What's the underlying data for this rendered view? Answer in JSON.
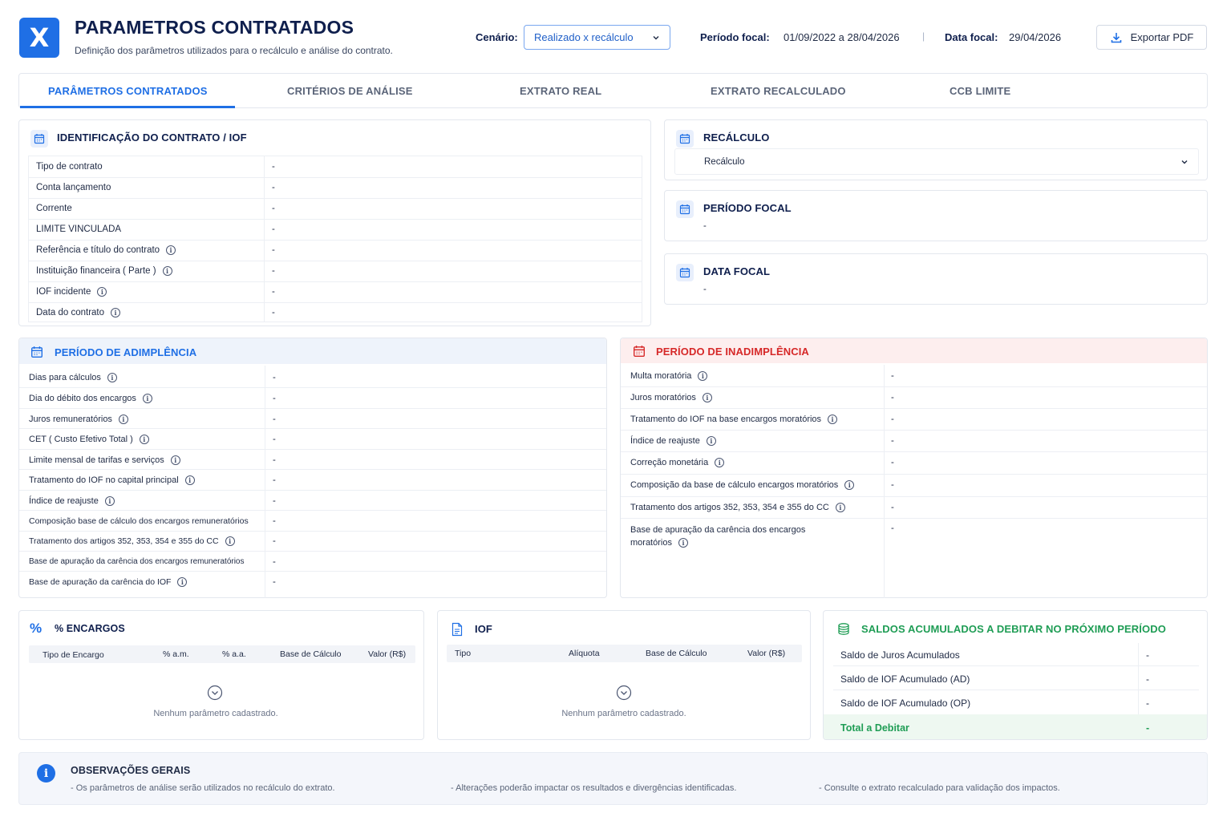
{
  "header": {
    "logo_letter": "X",
    "title": "PARAMETROS CONTRATADOS",
    "subtitle": "Definição dos parâmetros utilizados para o recálculo e análise do contrato.",
    "cenario_label": "Cenário:",
    "cenario_value": "Realizado x recálculo",
    "periodo_label": "Período focal:",
    "periodo_value": "01/09/2022 a 28/04/2026",
    "separator": "|",
    "data_label": "Data focal:",
    "data_value": "29/04/2026",
    "export_label": "Exportar PDF"
  },
  "tabs": [
    {
      "label": "PARÂMETROS CONTRATADOS",
      "active": true
    },
    {
      "label": "CRITÉRIOS DE ANÁLISE",
      "active": false
    },
    {
      "label": "EXTRATO REAL",
      "active": false
    },
    {
      "label": "EXTRATO RECALCULADO",
      "active": false
    },
    {
      "label": "CCB LIMITE",
      "active": false
    }
  ],
  "identificacao": {
    "title": "IDENTIFICAÇÃO DO CONTRATO / IOF",
    "rows": [
      {
        "label": "Tipo de contrato",
        "value": "-",
        "info": false
      },
      {
        "label": "Conta lançamento",
        "value": "-",
        "info": false
      },
      {
        "label": "Corrente",
        "value": "-",
        "info": false
      },
      {
        "label": "LIMITE VINCULADA",
        "value": "-",
        "info": false
      },
      {
        "label": "Referência e título do contrato",
        "value": "-",
        "info": true
      },
      {
        "label": "Instituição financeira ( Parte )",
        "value": "-",
        "info": true
      },
      {
        "label": "IOF incidente",
        "value": "-",
        "info": true
      },
      {
        "label": "Data do contrato",
        "value": "-",
        "info": true
      }
    ]
  },
  "recalculo": {
    "title": "RECÁLCULO",
    "select_value": "Recálculo"
  },
  "periodo_focal": {
    "title": "PERÍODO FOCAL",
    "value": "-"
  },
  "data_focal": {
    "title": "DATA FOCAL",
    "value": "-"
  },
  "adimplencia": {
    "title": "PERÍODO DE ADIMPLÊNCIA",
    "rows": [
      {
        "label": "Dias para cálculos",
        "value": "-",
        "info": true
      },
      {
        "label": "Dia do débito dos encargos",
        "value": "-",
        "info": true
      },
      {
        "label": "Juros remuneratórios",
        "value": "-",
        "info": true
      },
      {
        "label": "CET ( Custo Efetivo Total )",
        "value": "-",
        "info": true
      },
      {
        "label": "Limite mensal de tarifas e serviços",
        "value": "-",
        "info": true
      },
      {
        "label": "Tratamento do IOF no capital principal",
        "value": "-",
        "info": true
      },
      {
        "label": "Índice de reajuste",
        "value": "-",
        "info": true
      },
      {
        "label": "Composição base de cálculo dos encargos remuneratórios",
        "value": "-",
        "info": false
      },
      {
        "label": "Tratamento dos artigos 352, 353, 354 e 355 do CC",
        "value": "-",
        "info": true
      },
      {
        "label": "Base de apuração da carência dos encargos remuneratórios",
        "value": "-",
        "info": false
      },
      {
        "label": "Base de apuração da carência do IOF",
        "value": "-",
        "info": true
      }
    ]
  },
  "inadimplencia": {
    "title": "PERÍODO DE INADIMPLÊNCIA",
    "rows": [
      {
        "label": "Multa moratória",
        "value": "-",
        "info": true
      },
      {
        "label": "Juros moratórios",
        "value": "-",
        "info": true
      },
      {
        "label": "Tratamento do IOF na base encargos moratórios",
        "value": "-",
        "info": true
      },
      {
        "label": "Índice de reajuste",
        "value": "-",
        "info": true
      },
      {
        "label": "Correção monetária",
        "value": "-",
        "info": true
      },
      {
        "label": "Composição da base de cálculo encargos moratórios",
        "value": "-",
        "info": true
      },
      {
        "label": "Tratamento dos artigos 352, 353, 354 e 355 do CC",
        "value": "-",
        "info": true
      },
      {
        "label": "Base de apuração da carência dos encargos",
        "label2": "moratórios",
        "value": "-",
        "info": true
      }
    ]
  },
  "encargos": {
    "title": "% ENCARGOS",
    "columns": [
      "Tipo de Encargo",
      "% a.m.",
      "% a.a.",
      "Base de Cálculo",
      "Valor (R$)"
    ],
    "empty": "Nenhum parâmetro cadastrado."
  },
  "iof": {
    "title": "IOF",
    "columns": [
      "Tipo",
      "Alíquota",
      "Base de Cálculo",
      "Valor (R$)"
    ],
    "empty": "Nenhum parâmetro cadastrado."
  },
  "saldos": {
    "title": "SALDOS ACUMULADOS A DEBITAR NO PRÓXIMO PERÍODO",
    "rows": [
      {
        "label": "Saldo de Juros Acumulados",
        "value": "-"
      },
      {
        "label": "Saldo de IOF Acumulado (AD)",
        "value": "-"
      },
      {
        "label": "Saldo de IOF Acumulado (OP)",
        "value": "-"
      }
    ],
    "total_label": "Total a Debitar",
    "total_value": "-"
  },
  "observacoes": {
    "title": "OBSERVAÇÕES GERAIS",
    "items": [
      "- Os parâmetros de análise serão utilizados no recálculo do extrato.",
      "- Alterações poderão impactar os resultados e divergências identificadas.",
      "- Consulte o extrato recalculado para validação dos impactos."
    ]
  },
  "colors": {
    "primary": "#1f6fe5",
    "navy": "#0f1f4d",
    "danger": "#d62828",
    "danger_bg": "#fdeeee",
    "success": "#1f9d55",
    "success_bg": "#eef8f1"
  }
}
